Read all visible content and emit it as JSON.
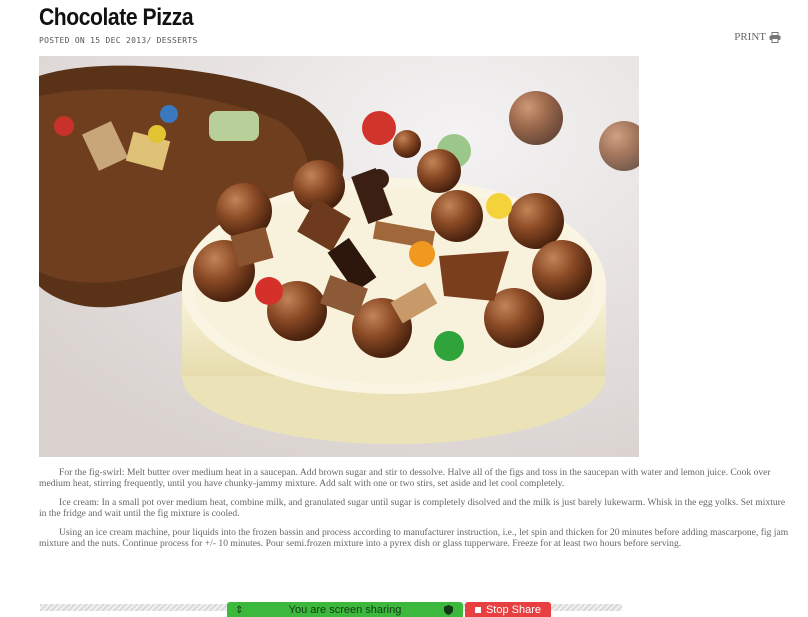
{
  "post": {
    "title": "Chocolate Pizza",
    "meta": "POSTED ON 15 DEC 2013/ DESSERTS",
    "print_label": "PRINT"
  },
  "image": {
    "icon": "photo",
    "alt": ""
  },
  "body": {
    "p1": "For the fig-swirl: Melt butter over medium heat in a saucepan. Add brown sugar and stir to dessolve. Halve all of the figs and toss in the saucepan with water and lemon juice. Cook over medium heat, stirring frequently, until you have chunky-jammy mixture. Add salt with one or two stirs, set aside and let cool completely.",
    "p2": "Ice cream: In a small pot over medium heat, combine milk, and granulated sugar until sugar is completely disolved and the milk is just barely lukewarm. Whisk in the egg yolks. Set mixture in the fridge and wait until the fig mixture is cooled.",
    "p3": "Using an ice cream machine, pour liquids into the frozen bassin and process according to manufacturer instruction, i.e., let spin and thicken for 20 minutes before adding mascarpone, fig jam mixture and the nuts. Continue process for +/- 10 minutes. Pour semi.frozen mixture into a pyrex dish or glass tupperware. Freeze for at least two hours before serving."
  },
  "share_bar": {
    "text": "You are screen sharing",
    "stop_label": "Stop Share",
    "colors": {
      "bar": "#3cb83c",
      "stop": "#e84040"
    }
  }
}
